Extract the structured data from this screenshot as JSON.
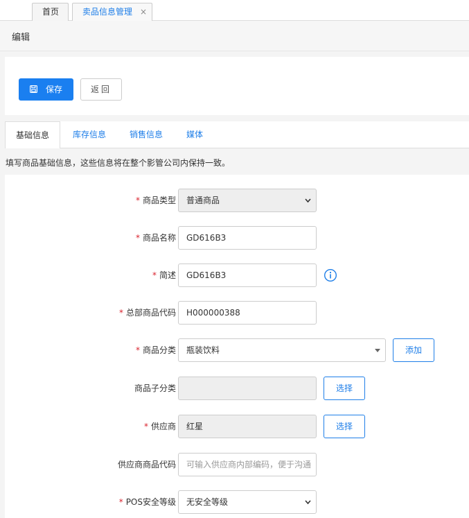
{
  "top_tabs": {
    "home": "首页",
    "active": "卖品信息管理",
    "close": "×"
  },
  "header": {
    "title": "编辑"
  },
  "toolbar": {
    "save_label": "保存",
    "back_label": "返回"
  },
  "tabs": [
    "基础信息",
    "库存信息",
    "销售信息",
    "媒体"
  ],
  "info_text": "填写商品基础信息，这些信息将在整个影管公司内保持一致。",
  "form": {
    "required_mark": "*",
    "product_type": {
      "label": "商品类型",
      "value": "普通商品"
    },
    "product_name": {
      "label": "商品名称",
      "value": "GD616B3"
    },
    "summary": {
      "label": "简述",
      "value": "GD616B3"
    },
    "hq_code": {
      "label": "总部商品代码",
      "value": "H000000388"
    },
    "category": {
      "label": "商品分类",
      "value": "瓶装饮料",
      "add_label": "添加"
    },
    "subcategory": {
      "label": "商品子分类",
      "value": "",
      "select_label": "选择"
    },
    "supplier": {
      "label": "供应商",
      "value": "红星",
      "select_label": "选择"
    },
    "supplier_code": {
      "label": "供应商商品代码",
      "placeholder": "可输入供应商内部编码，便于沟通"
    },
    "pos_level": {
      "label": "POS安全等级",
      "value": "无安全等级"
    }
  },
  "colors": {
    "primary": "#1a7ff0",
    "required": "#d9232e",
    "link": "#1e7ee8"
  }
}
